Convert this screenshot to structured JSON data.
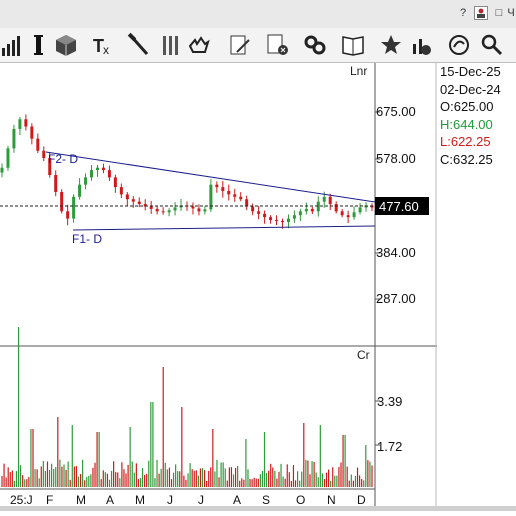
{
  "titlebar": {
    "controls": [
      "?",
      "□",
      "Ч"
    ]
  },
  "toolbar": {
    "icons": [
      "bar-chart-icon",
      "crosshair-icon",
      "cube-icon",
      "text-tool-icon",
      "hammer-icon",
      "parallel-lines-icon",
      "hand-pointer-icon",
      "edit-document-icon",
      "delete-document-icon",
      "link-icon",
      "book-icon",
      "star-icon",
      "alert-chart-icon",
      "refresh-icon",
      "search-settings-icon"
    ]
  },
  "chart": {
    "price_scale_label": "Lnr",
    "volume_scale_label": "Cr",
    "current_price": "477.60",
    "trendline_labels": [
      "F2- D",
      "F1- D"
    ],
    "price_ticks": [
      "675.00",
      "578.00",
      "384.00",
      "287.00"
    ],
    "volume_ticks": [
      "3.39",
      "1.72"
    ],
    "month_labels": [
      "25:J",
      "F",
      "M",
      "A",
      "M",
      "J",
      "J",
      "A",
      "S",
      "O",
      "N",
      "D"
    ]
  },
  "info": {
    "date1": "15-Dec-25",
    "date2": "02-Dec-24",
    "open": "O:625.00",
    "high": "H:644.00",
    "low": "L:622.25",
    "close": "C:632.25"
  },
  "colors": {
    "up": "#2e9b3a",
    "down": "#d01a1a",
    "trendline": "#1b1f8a",
    "high_text": "#1f9b3a",
    "low_text": "#d01a1a",
    "price_tag_bg": "#000000"
  },
  "chart_data": {
    "type": "candlestick",
    "x_axis_months": [
      "Jan 2025",
      "Feb",
      "Mar",
      "Apr",
      "May",
      "Jun",
      "Jul",
      "Aug",
      "Sep",
      "Oct",
      "Nov",
      "Dec"
    ],
    "y_ticks": [
      287,
      384,
      578,
      675
    ],
    "last_price": 477.6,
    "close_series": [
      560,
      600,
      640,
      660,
      645,
      620,
      595,
      580,
      545,
      510,
      470,
      455,
      500,
      525,
      540,
      555,
      560,
      555,
      540,
      520,
      505,
      495,
      490,
      485,
      480,
      475,
      470,
      468,
      472,
      478,
      482,
      480,
      476,
      470,
      474,
      525,
      520,
      512,
      505,
      500,
      495,
      480,
      470,
      465,
      458,
      452,
      450,
      448,
      455,
      462,
      470,
      475,
      470,
      490,
      500,
      485,
      470,
      462,
      458,
      468,
      478,
      482,
      478
    ]
  }
}
